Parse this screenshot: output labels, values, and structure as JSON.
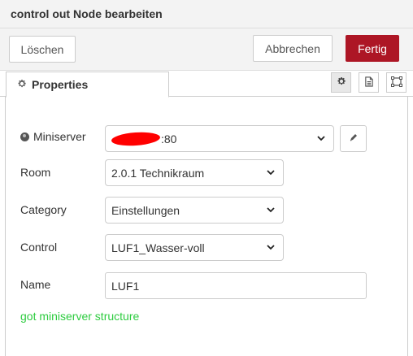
{
  "tray": {
    "title": "control out Node bearbeiten"
  },
  "toolbar": {
    "delete_label": "Löschen",
    "cancel_label": "Abbrechen",
    "done_label": "Fertig"
  },
  "tabs": {
    "active_label": "Properties",
    "icons": [
      "gear-icon",
      "description-icon",
      "appearance-icon"
    ]
  },
  "form": {
    "miniserver": {
      "label": "Miniserver",
      "value_suffix": ":80"
    },
    "room": {
      "label": "Room",
      "value": "2.0.1 Technikraum"
    },
    "category": {
      "label": "Category",
      "value": "Einstellungen"
    },
    "control": {
      "label": "Control",
      "value": "LUF1_Wasser-voll"
    },
    "name": {
      "label": "Name",
      "value": "LUF1"
    }
  },
  "status": {
    "text": "got miniserver structure",
    "color": "#2ecc40"
  },
  "colors": {
    "primary": "#ad1625",
    "border": "#cccccc",
    "header_bg": "#f3f3f3"
  }
}
